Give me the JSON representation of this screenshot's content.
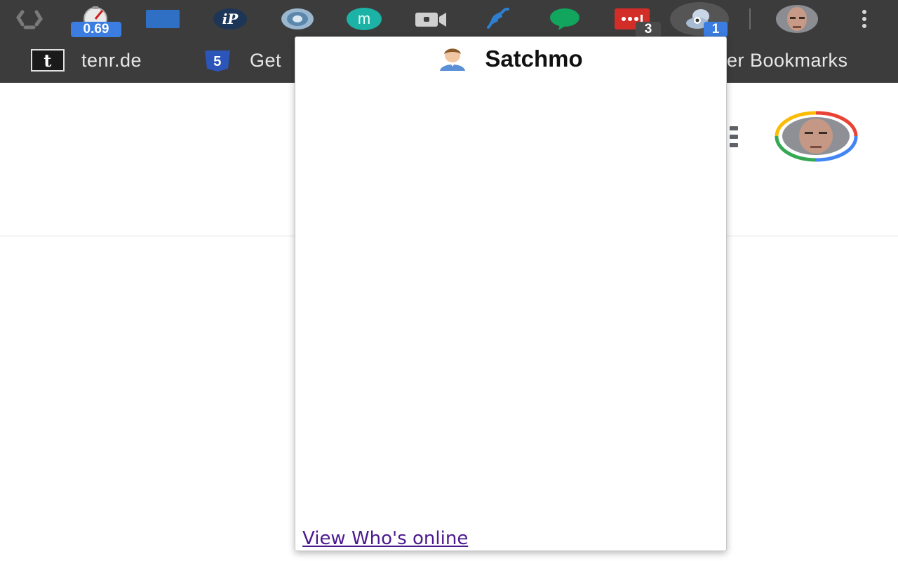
{
  "toolbar": {
    "extensions": [
      {
        "name": "recycle-icon"
      },
      {
        "name": "speedometer-icon",
        "badge": "0.69"
      },
      {
        "name": "blue-square-icon"
      },
      {
        "name": "ip-icon",
        "label": "iP"
      },
      {
        "name": "swirl-icon"
      },
      {
        "name": "m-icon",
        "label": "m"
      },
      {
        "name": "video-icon"
      },
      {
        "name": "rope-icon"
      },
      {
        "name": "chat-bubble-icon"
      },
      {
        "name": "lastpass-icon",
        "badge": "3"
      },
      {
        "name": "satchmo-icon",
        "badge": "1",
        "active": true
      }
    ],
    "menu_icon": "kebab-menu-icon",
    "colors": {
      "chrome_bg": "#3c3c3c",
      "badge_blue": "#3b7de0",
      "badge_dark": "#4a4a4a"
    }
  },
  "bookmarks": {
    "items": [
      {
        "label": "tenr.de",
        "icon": "t-square-icon"
      },
      {
        "label": "Get",
        "icon": "html5-icon"
      }
    ],
    "other_label": "er Bookmarks"
  },
  "page": {
    "apps_icon": "apps-grid-icon",
    "avatar_ring_colors": [
      "#ea4335",
      "#4285f4",
      "#34a853",
      "#fbbc05"
    ]
  },
  "popup": {
    "title": "Satchmo",
    "user_icon": "user-avatar-icon",
    "link_label": "View Who's online",
    "link_color": "#4b1a8f"
  }
}
